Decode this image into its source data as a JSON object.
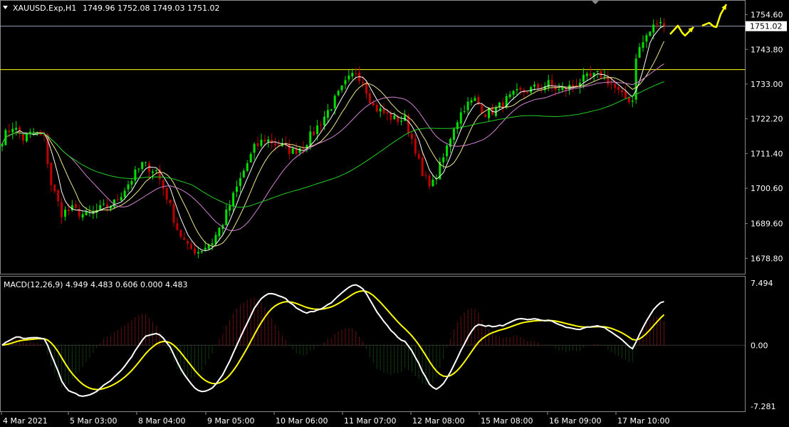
{
  "window": {
    "symbol_line": "XAUUSD.Exp,H1",
    "ohlc": "1749.96 1752.08 1749.03 1751.02",
    "indicator_line": "MACD(12,26,9) 4.949 4.483 0.606 0.000 4.483",
    "current_price": "1751.02"
  },
  "colors": {
    "background": "#000000",
    "bull": "#00e000",
    "bear": "#c00000",
    "ma_fast": "#ffffff",
    "ma_mid": "#f0e68c",
    "ma_slow": "#d080d0",
    "ma_long": "#22cc22",
    "level": "#ffff00",
    "macd": "#ffffff",
    "signal": "#ffff00",
    "hist_pos": "#c02020",
    "hist_neg": "#1e6e1e",
    "arrow": "#ffff00",
    "grid": "#888888"
  },
  "chart_data": [
    {
      "type": "candlestick",
      "title": "XAUUSD.Exp,H1",
      "y_ticks": [
        "1754.60",
        "1743.80",
        "1733.00",
        "1722.20",
        "1711.40",
        "1700.60",
        "1689.60",
        "1678.80"
      ],
      "y_tick_values": [
        1754.6,
        1743.8,
        1733.0,
        1722.2,
        1711.4,
        1700.6,
        1689.6,
        1678.8
      ],
      "ylim": [
        1674.0,
        1758.5
      ],
      "x_ticks": [
        "4 Mar 2021",
        "5 Mar 03:00",
        "8 Mar 04:00",
        "9 Mar 05:00",
        "10 Mar 06:00",
        "11 Mar 07:00",
        "12 Mar 08:00",
        "15 Mar 08:00",
        "16 Mar 09:00",
        "17 Mar 10:00"
      ],
      "current_price": 1751.02,
      "horizontal_level": 1737.5,
      "path_keypoints": [
        [
          0,
          1716
        ],
        [
          3,
          1720
        ],
        [
          6,
          1716
        ],
        [
          9,
          1718
        ],
        [
          12,
          1716
        ],
        [
          14,
          1702
        ],
        [
          17,
          1693
        ],
        [
          20,
          1694
        ],
        [
          24,
          1692
        ],
        [
          28,
          1694
        ],
        [
          32,
          1696
        ],
        [
          36,
          1702
        ],
        [
          40,
          1708
        ],
        [
          44,
          1706
        ],
        [
          47,
          1698
        ],
        [
          50,
          1688
        ],
        [
          53,
          1682
        ],
        [
          56,
          1681
        ],
        [
          60,
          1684
        ],
        [
          63,
          1690
        ],
        [
          66,
          1698
        ],
        [
          69,
          1706
        ],
        [
          72,
          1713
        ],
        [
          75,
          1716
        ],
        [
          79,
          1714
        ],
        [
          83,
          1712
        ],
        [
          86,
          1714
        ],
        [
          89,
          1718
        ],
        [
          92,
          1723
        ],
        [
          95,
          1728
        ],
        [
          98,
          1733
        ],
        [
          101,
          1737
        ],
        [
          103,
          1734
        ],
        [
          106,
          1726
        ],
        [
          109,
          1724
        ],
        [
          112,
          1722
        ],
        [
          115,
          1722
        ],
        [
          118,
          1713
        ],
        [
          120,
          1704
        ],
        [
          123,
          1702
        ],
        [
          126,
          1710
        ],
        [
          129,
          1720
        ],
        [
          132,
          1726
        ],
        [
          135,
          1728
        ],
        [
          138,
          1724
        ],
        [
          141,
          1725
        ],
        [
          144,
          1728
        ],
        [
          147,
          1730
        ],
        [
          150,
          1731
        ],
        [
          153,
          1732
        ],
        [
          156,
          1733
        ],
        [
          159,
          1731
        ],
        [
          162,
          1732
        ],
        [
          165,
          1734
        ],
        [
          168,
          1735
        ],
        [
          171,
          1736
        ],
        [
          174,
          1733
        ],
        [
          177,
          1729
        ],
        [
          180,
          1728
        ],
        [
          181,
          1742
        ],
        [
          184,
          1748
        ],
        [
          187,
          1752
        ],
        [
          189,
          1751.02
        ]
      ],
      "candle_count": 190,
      "forecast_arrows": [
        [
          [
            1741,
            48
          ],
          [
            1752,
            36
          ],
          [
            1758,
            46
          ],
          [
            1762,
            50
          ],
          [
            1768,
            44
          ],
          [
            1774,
            38
          ]
        ],
        [
          [
            1786,
            36
          ],
          [
            1796,
            32
          ],
          [
            1802,
            37
          ],
          [
            1806,
            38
          ],
          [
            1812,
            20
          ],
          [
            1820,
            6
          ]
        ]
      ],
      "moving_averages": [
        {
          "period": 5
        },
        {
          "period": 10
        },
        {
          "period": 20
        },
        {
          "period": 55
        }
      ]
    },
    {
      "type": "macd",
      "title": "MACD(12,26,9)",
      "values_readout": [
        4.949,
        4.483,
        0.606,
        0.0,
        4.483
      ],
      "y_ticks": [
        "7.494",
        "0.00",
        "-7.281"
      ],
      "y_tick_values": [
        7.494,
        0.0,
        -7.281
      ],
      "ylim": [
        -7.281,
        7.494
      ]
    }
  ]
}
